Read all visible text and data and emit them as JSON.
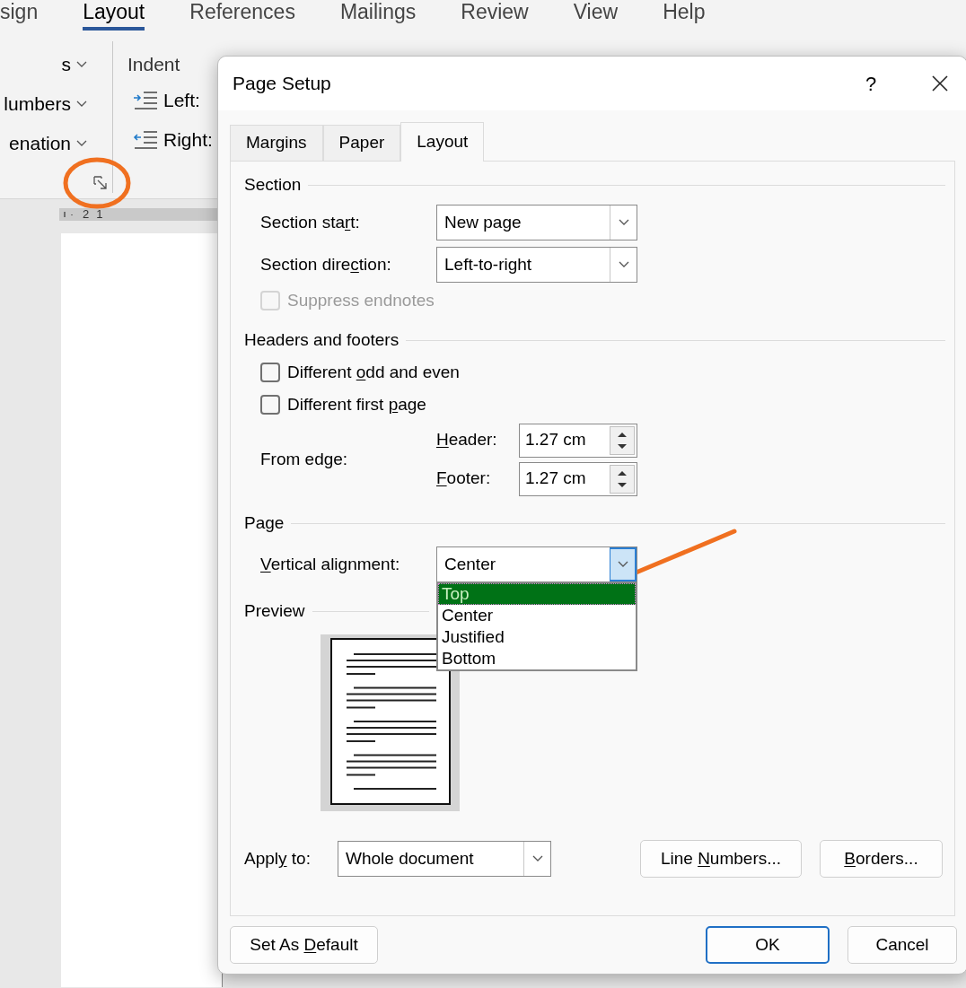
{
  "ribbon_tabs": [
    {
      "label": "sign",
      "selected": false
    },
    {
      "label": "Layout",
      "selected": true
    },
    {
      "label": "References",
      "selected": false
    },
    {
      "label": "Mailings",
      "selected": false
    },
    {
      "label": "Review",
      "selected": false
    },
    {
      "label": "View",
      "selected": false
    },
    {
      "label": "Help",
      "selected": false
    }
  ],
  "ribbon": {
    "menu_items": [
      "s",
      "lumbers",
      "enation"
    ],
    "indent": {
      "title": "Indent",
      "items": [
        {
          "label": "Left:",
          "kind": "left"
        },
        {
          "label": "Right:",
          "kind": "right"
        }
      ]
    }
  },
  "ruler": [
    "2",
    "1"
  ],
  "dialog": {
    "title": "Page Setup",
    "help": "?",
    "tabs": [
      {
        "label": "Margins",
        "selected": false
      },
      {
        "label": "Paper",
        "selected": false
      },
      {
        "label": "Layout",
        "selected": true
      }
    ],
    "section": {
      "title": "Section",
      "dropdowns": [
        {
          "label": [
            {
              "text": "Section sta"
            },
            {
              "text": "r",
              "underlined": true
            },
            {
              "text": "t:"
            }
          ],
          "value": "New page"
        },
        {
          "label": [
            {
              "text": "Section dire"
            },
            {
              "text": "c",
              "underlined": true
            },
            {
              "text": "tion:"
            }
          ],
          "value": "Left-to-right"
        }
      ],
      "suppress_endnotes": {
        "label": "Suppress endnotes",
        "checked": false,
        "disabled": true
      }
    },
    "headers_footers": {
      "title": "Headers and footers",
      "checkboxes": [
        {
          "label": [
            {
              "text": "Different "
            },
            {
              "text": "o",
              "underlined": true
            },
            {
              "text": "dd and even"
            }
          ],
          "checked": false,
          "disabled": false
        },
        {
          "label": [
            {
              "text": "Different first "
            },
            {
              "text": "p",
              "underlined": true
            },
            {
              "text": "age"
            }
          ],
          "checked": false,
          "disabled": false
        }
      ],
      "from_edge": "From edge:",
      "spinners": [
        {
          "label": [
            {
              "text": "H",
              "underlined": true
            },
            {
              "text": "eader:"
            }
          ],
          "value": "1.27 cm"
        },
        {
          "label": [
            {
              "text": "F",
              "underlined": true
            },
            {
              "text": "ooter:"
            }
          ],
          "value": "1.27 cm"
        }
      ]
    },
    "page": {
      "title": "Page",
      "vertical_alignment": {
        "label": [
          {
            "text": "V",
            "underlined": true
          },
          {
            "text": "ertical alignment:"
          }
        ],
        "value": "Center",
        "expanded": true,
        "options": [
          {
            "label": "Top",
            "highlighted": true
          },
          {
            "label": "Center",
            "highlighted": false
          },
          {
            "label": "Justified",
            "highlighted": false
          },
          {
            "label": "Bottom",
            "highlighted": false
          }
        ]
      }
    },
    "preview": {
      "title": "Preview"
    },
    "apply_to": {
      "label": [
        {
          "text": "Appl"
        },
        {
          "text": "y",
          "underlined": true
        },
        {
          "text": " to:"
        }
      ],
      "value": "Whole document"
    },
    "buttons": [
      {
        "label": [
          {
            "text": "Line "
          },
          {
            "text": "N",
            "underlined": true
          },
          {
            "text": "umbers..."
          }
        ]
      },
      {
        "label": [
          {
            "text": "B",
            "underlined": true
          },
          {
            "text": "orders..."
          }
        ]
      }
    ],
    "footer_buttons": [
      {
        "label": [
          {
            "text": "Set As "
          },
          {
            "text": "D",
            "underlined": true
          },
          {
            "text": "efault"
          }
        ],
        "default": false
      },
      {
        "label": [
          {
            "text": "OK"
          }
        ],
        "default": true
      },
      {
        "label": [
          {
            "text": "Cancel"
          }
        ],
        "default": false
      }
    ]
  }
}
